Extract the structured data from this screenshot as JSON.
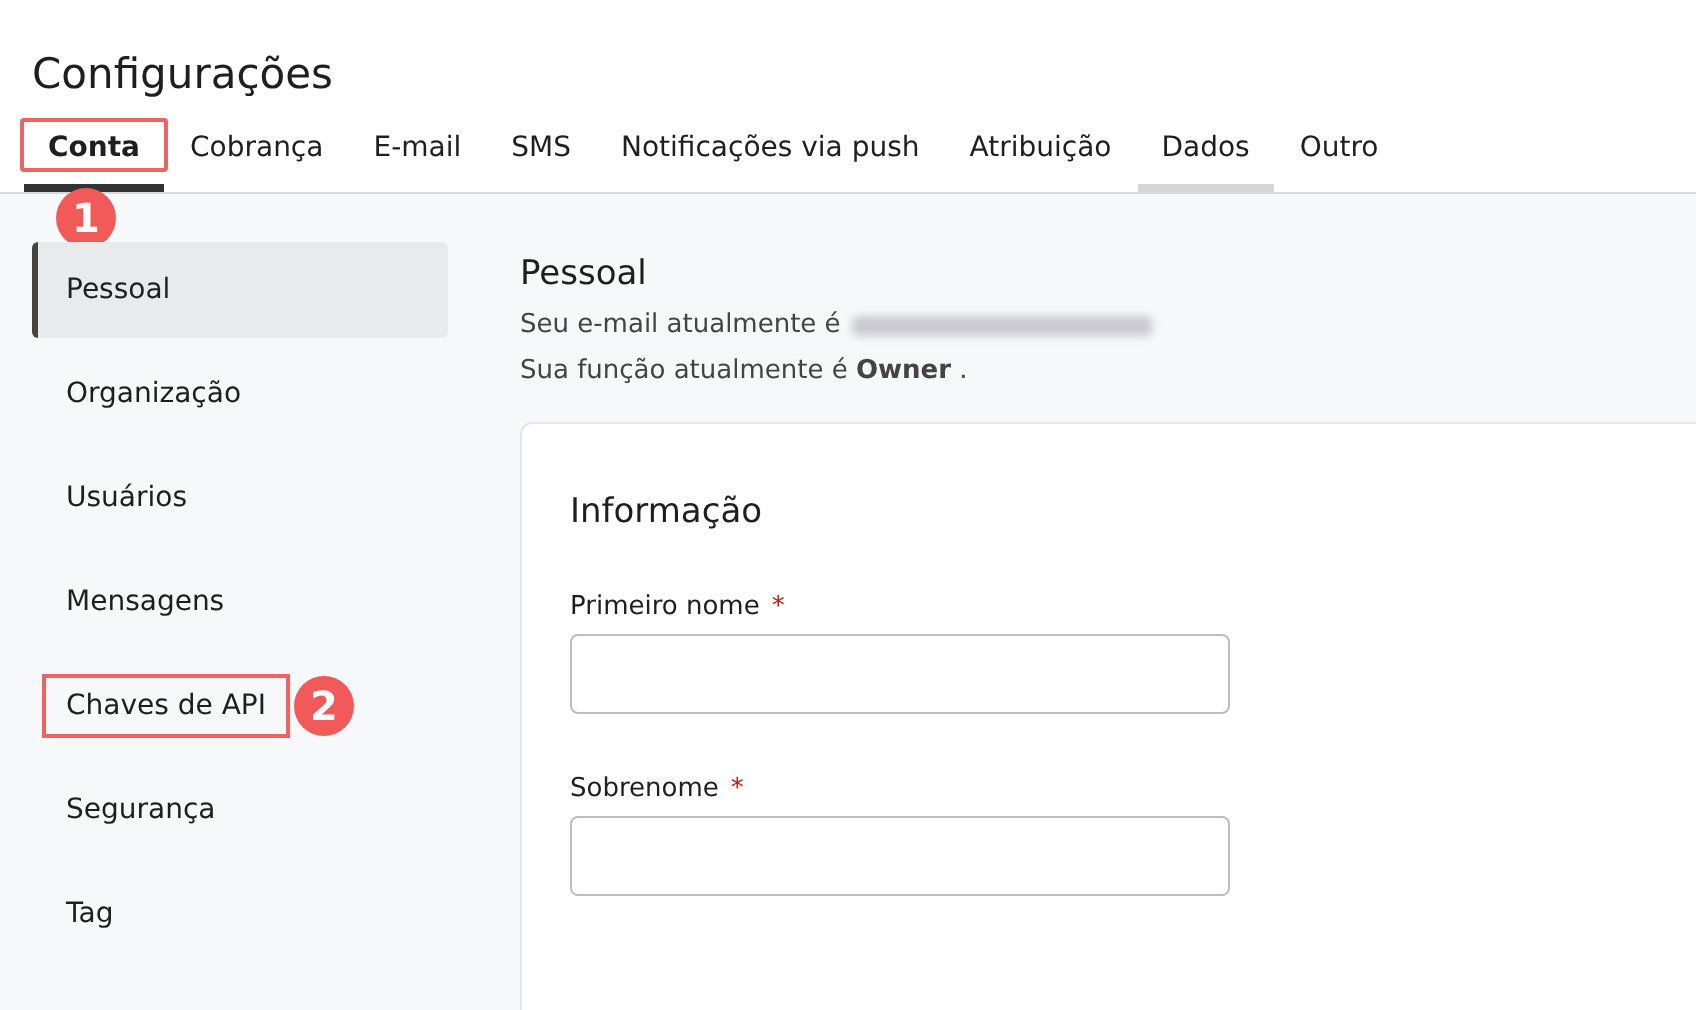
{
  "title": "Configurações",
  "tabs": [
    {
      "label": "Conta",
      "selected": true,
      "hovered": false,
      "callout": "1"
    },
    {
      "label": "Cobrança",
      "selected": false,
      "hovered": false
    },
    {
      "label": "E-mail",
      "selected": false,
      "hovered": false
    },
    {
      "label": "SMS",
      "selected": false,
      "hovered": false
    },
    {
      "label": "Notificações via push",
      "selected": false,
      "hovered": false
    },
    {
      "label": "Atribuição",
      "selected": false,
      "hovered": false
    },
    {
      "label": "Dados",
      "selected": false,
      "hovered": true
    },
    {
      "label": "Outro",
      "selected": false,
      "hovered": false
    }
  ],
  "sidebar": {
    "items": [
      {
        "label": "Pessoal",
        "selected": true
      },
      {
        "label": "Organização",
        "selected": false
      },
      {
        "label": "Usuários",
        "selected": false
      },
      {
        "label": "Mensagens",
        "selected": false
      },
      {
        "label": "Chaves de API",
        "selected": false,
        "callout": "2"
      },
      {
        "label": "Segurança",
        "selected": false
      },
      {
        "label": "Tag",
        "selected": false
      }
    ]
  },
  "section": {
    "heading": "Pessoal",
    "email_line": "Seu e-mail atualmente é",
    "role_line": "Sua função atualmente é **Owner** ."
  },
  "card": {
    "heading": "Informação",
    "required_mark": "*",
    "fields": [
      {
        "label": "Primeiro nome",
        "required": true
      },
      {
        "label": "Sobrenome",
        "required": true
      }
    ]
  }
}
